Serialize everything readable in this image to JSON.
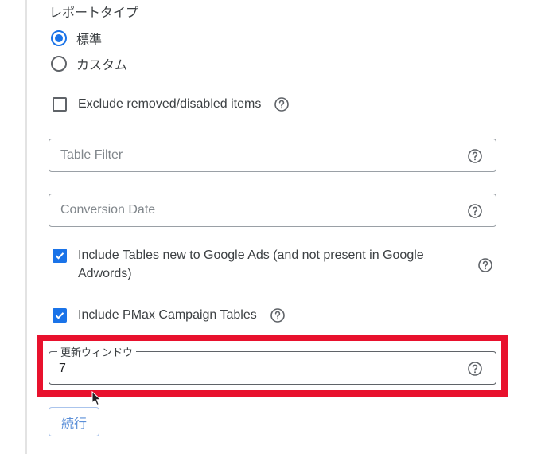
{
  "report_type": {
    "title": "レポートタイプ",
    "options": [
      {
        "label": "標準",
        "selected": true
      },
      {
        "label": "カスタム",
        "selected": false
      }
    ]
  },
  "exclude_removed": {
    "label": "Exclude removed/disabled items",
    "checked": false
  },
  "table_filter": {
    "placeholder": "Table Filter"
  },
  "conversion_date": {
    "placeholder": "Conversion Date"
  },
  "include_new_tables": {
    "label_line1": "Include Tables new to Google Ads (and not present in Google",
    "label_line2": "Adwords)",
    "checked": true
  },
  "include_pmax": {
    "label": "Include PMax Campaign Tables",
    "checked": true
  },
  "refresh_window": {
    "label": "更新ウィンドウ",
    "value": "7"
  },
  "continue_button": {
    "label": "続行"
  },
  "colors": {
    "accent": "#1a73e8",
    "highlight": "#e8112d"
  }
}
